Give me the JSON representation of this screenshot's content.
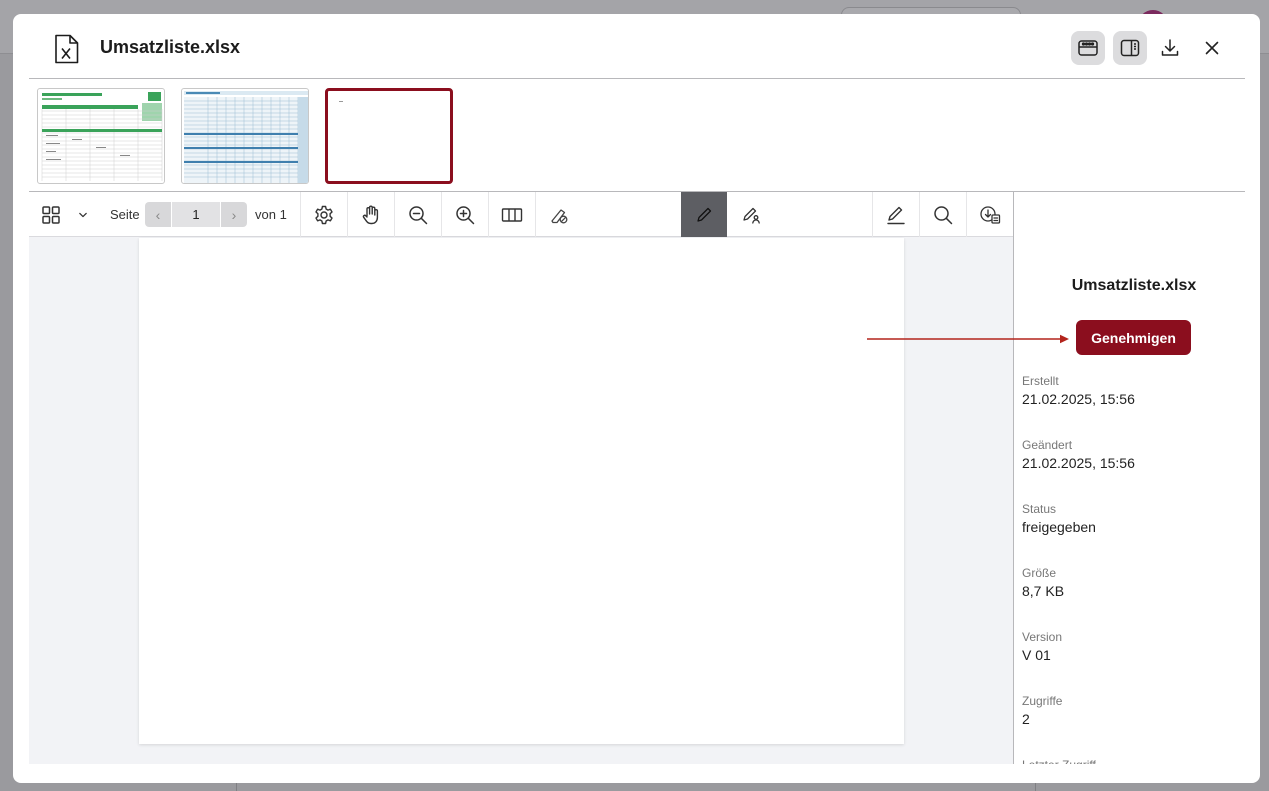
{
  "dialog": {
    "title": "Umsatzliste.xlsx",
    "header_buttons": [
      {
        "name": "thumbnail-strip-toggle",
        "icon": "thumbnails-icon",
        "active": true
      },
      {
        "name": "sidebar-toggle",
        "icon": "sidebar-panel-icon",
        "active": true
      },
      {
        "name": "download",
        "icon": "download-icon",
        "active": false
      },
      {
        "name": "close",
        "icon": "close-icon",
        "active": false
      }
    ]
  },
  "thumbnails": [
    {
      "name": "sheet-1",
      "selected": false
    },
    {
      "name": "sheet-2",
      "selected": false
    },
    {
      "name": "sheet-3",
      "selected": true
    }
  ],
  "toolbar": {
    "page_label": "Seite",
    "current_page": "1",
    "of_label": "von 1",
    "icons": [
      "grid-icon",
      "chevron-down-icon",
      "chevron-left-icon",
      "chevron-right-icon",
      "gear-icon",
      "hand-icon",
      "zoom-out-icon",
      "zoom-in-icon",
      "two-page-icon",
      "eraser-icon",
      "pen-icon",
      "signature-icon",
      "annotate-pencil-icon",
      "search-icon",
      "download-attachments-icon"
    ]
  },
  "sidebar": {
    "title": "Umsatzliste.xlsx",
    "approve_label": "Genehmigen",
    "accent_color": "#8b0e1e",
    "meta": [
      {
        "key": "Erstellt",
        "value": "21.02.2025, 15:56"
      },
      {
        "key": "Geändert",
        "value": "21.02.2025, 15:56"
      },
      {
        "key": "Status",
        "value": "freigegeben"
      },
      {
        "key": "Größe",
        "value": "8,7 KB"
      },
      {
        "key": "Version",
        "value": "V 01"
      },
      {
        "key": "Zugriffe",
        "value": "2"
      },
      {
        "key": "Letzter Zugriff",
        "value": ""
      }
    ]
  }
}
